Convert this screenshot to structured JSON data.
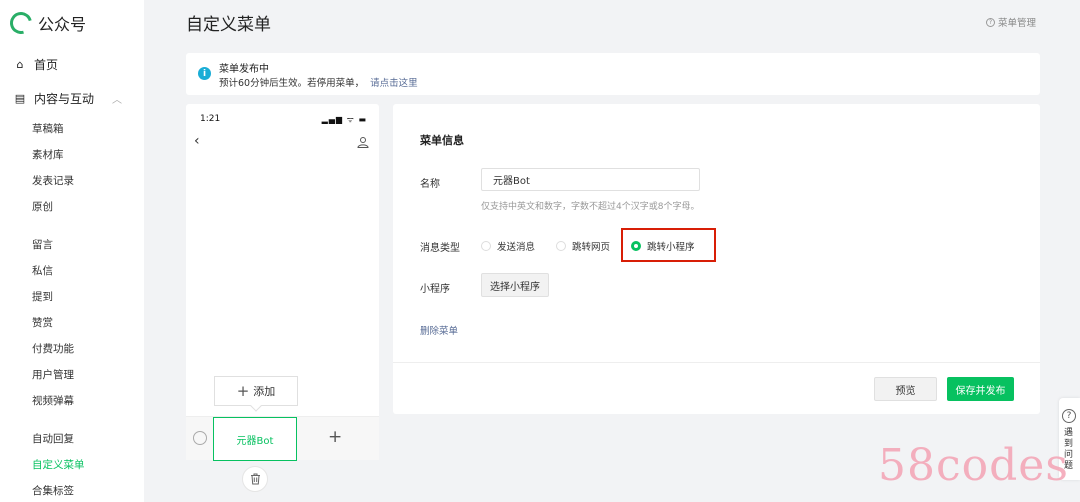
{
  "brand": {
    "name": "公众号",
    "color": "#2aae67"
  },
  "header": {
    "title": "自定义菜单",
    "menu_manage": "菜单管理"
  },
  "sidebar": {
    "home": "首页",
    "content": "内容与互动",
    "items": [
      "草稿箱",
      "素材库",
      "发表记录",
      "原创",
      "留言",
      "私信",
      "提到",
      "赞赏",
      "付费功能",
      "用户管理",
      "视频弹幕",
      "自动回复",
      "自定义菜单",
      "合集标签"
    ],
    "active_item": "自定义菜单"
  },
  "notice": {
    "title": "菜单发布中",
    "desc": "预计60分钟后生效。若停用菜单，",
    "link": "请点击这里"
  },
  "phone": {
    "time": "1:21",
    "status": "▂▄▆ ᯤ ▬",
    "add_label": "添加",
    "menu_tab": "元器Bot"
  },
  "form": {
    "section_title": "菜单信息",
    "name_label": "名称",
    "name_value": "元器Bot",
    "name_hint": "仅支持中英文和数字，字数不超过4个汉字或8个字母。",
    "msg_type_label": "消息类型",
    "options": [
      "发送消息",
      "跳转网页",
      "跳转小程序"
    ],
    "selected_option": "跳转小程序",
    "mini_label": "小程序",
    "mini_button": "选择小程序",
    "delete_link": "删除菜单",
    "preview_button": "预览",
    "publish_button": "保存并发布"
  },
  "help": {
    "text": "遇到问题"
  },
  "watermark": "58codes",
  "colors": {
    "accent": "#07c160",
    "link": "#576b95",
    "highlight": "#d81e06"
  }
}
